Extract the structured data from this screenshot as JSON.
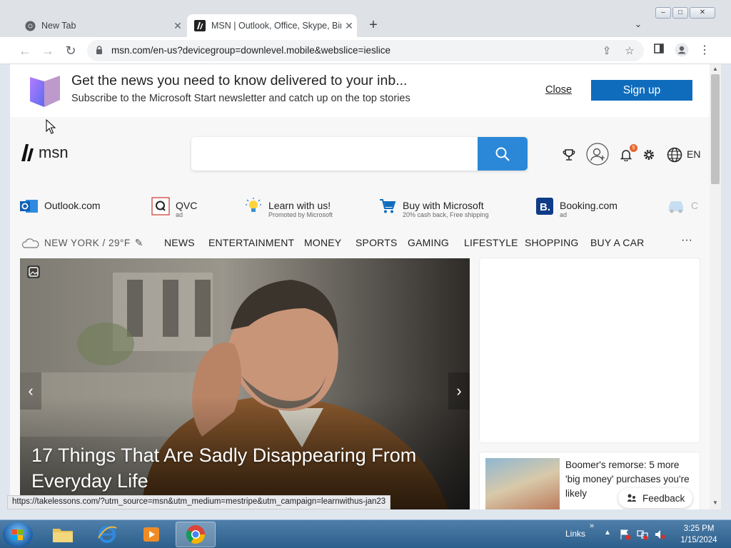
{
  "browser": {
    "tabs": [
      {
        "title": "New Tab",
        "icon": "chrome-icon"
      },
      {
        "title": "MSN | Outlook, Office, Skype, Bing",
        "icon": "msn-icon"
      }
    ],
    "url": "msn.com/en-us?devicegroup=downlevel.mobile&webslice=ieslice",
    "status_url": "https://takelessons.com/?utm_source=msn&utm_medium=mestripe&utm_campaign=learnwithus-jan23"
  },
  "newsletter": {
    "headline": "Get the news you need to know delivered to your inb...",
    "subtext": "Subscribe to the Microsoft Start newsletter and catch up on the top stories",
    "close_label": "Close",
    "signup_label": "Sign up",
    "accent": "#0f6cbd"
  },
  "header": {
    "logo_text": "msn",
    "search_placeholder": "",
    "notification_count": "5",
    "language": "EN"
  },
  "quick_links": [
    {
      "label": "Outlook.com",
      "sub": "",
      "icon": "outlook-icon"
    },
    {
      "label": "QVC",
      "sub": "ad",
      "icon": "qvc-icon"
    },
    {
      "label": "Learn with us!",
      "sub": "Promoted by Microsoft",
      "icon": "lightbulb-icon"
    },
    {
      "label": "Buy with Microsoft",
      "sub": "20% cash back, Free shipping",
      "icon": "cart-icon"
    },
    {
      "label": "Booking.com",
      "sub": "ad",
      "icon": "booking-icon"
    },
    {
      "label": "C",
      "sub": "",
      "icon": "car-icon"
    }
  ],
  "nav": {
    "weather": "NEW YORK / 29°F",
    "items": [
      "NEWS",
      "ENTERTAINMENT",
      "MONEY",
      "SPORTS",
      "GAMING",
      "LIFESTYLE",
      "SHOPPING",
      "BUY A CAR"
    ],
    "more": "···"
  },
  "hero": {
    "title": "17 Things That Are Sadly Disappearing From Everyday Life"
  },
  "side_card": {
    "title": "Boomer's remorse: 5 more 'big money' purchases you're likely"
  },
  "feedback_label": "Feedback",
  "taskbar": {
    "links_label": "Links",
    "time": "3:25 PM",
    "date": "1/15/2024"
  }
}
